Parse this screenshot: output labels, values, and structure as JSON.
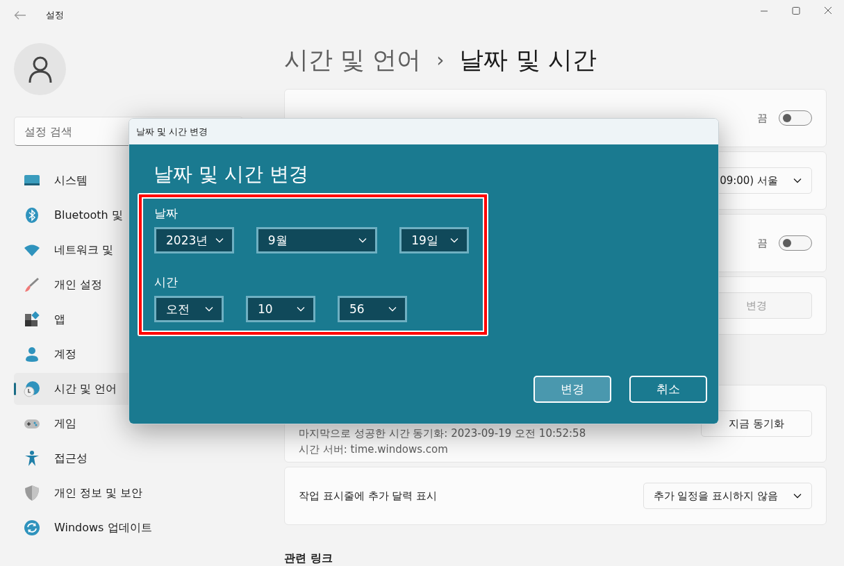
{
  "window": {
    "title": "설정"
  },
  "sidebar": {
    "search": {
      "placeholder": "설정 검색"
    },
    "items": [
      {
        "label": "시스템",
        "selected": false
      },
      {
        "label": "Bluetooth 및",
        "selected": false
      },
      {
        "label": "네트워크 및",
        "selected": false
      },
      {
        "label": "개인 설정",
        "selected": false
      },
      {
        "label": "앱",
        "selected": false
      },
      {
        "label": "계정",
        "selected": false
      },
      {
        "label": "시간 및 언어",
        "selected": true
      },
      {
        "label": "게임",
        "selected": false
      },
      {
        "label": "접근성",
        "selected": false
      },
      {
        "label": "개인 정보 및 보안",
        "selected": false
      },
      {
        "label": "Windows 업데이트",
        "selected": false
      }
    ]
  },
  "breadcrumb": {
    "parent": "시간 및 언어",
    "separator": "›",
    "current": "날짜 및 시간"
  },
  "cards": [
    {
      "kind": "toggle",
      "state_text": "끔",
      "on": false
    },
    {
      "kind": "dropdown",
      "value": "09:00) 서울"
    },
    {
      "kind": "toggle",
      "state_text": "끔",
      "on": false
    },
    {
      "kind": "button",
      "button": "변경",
      "disabled": true
    },
    {
      "kind": "sync",
      "lines": [
        "마지막으로 성공한 시간 동기화: 2023-09-19 오전 10:52:58",
        "시간 서버: time.windows.com"
      ],
      "button": "지금 동기화"
    },
    {
      "kind": "labeled_dropdown",
      "label": "작업 표시줄에 추가 달력 표시",
      "value": "추가 일정을 표시하지 않음"
    }
  ],
  "related_links_heading": "관련 링크",
  "dialog": {
    "title": "날짜 및 시간 변경",
    "heading": "날짜 및 시간 변경",
    "date_label": "날짜",
    "date_fields": [
      {
        "value": "2023년"
      },
      {
        "value": "9월"
      },
      {
        "value": "19일"
      }
    ],
    "time_label": "시간",
    "time_fields": [
      {
        "value": "오전"
      },
      {
        "value": "10"
      },
      {
        "value": "56"
      }
    ],
    "buttons": [
      {
        "label": "변경",
        "default": true
      },
      {
        "label": "취소",
        "default": false
      }
    ]
  }
}
